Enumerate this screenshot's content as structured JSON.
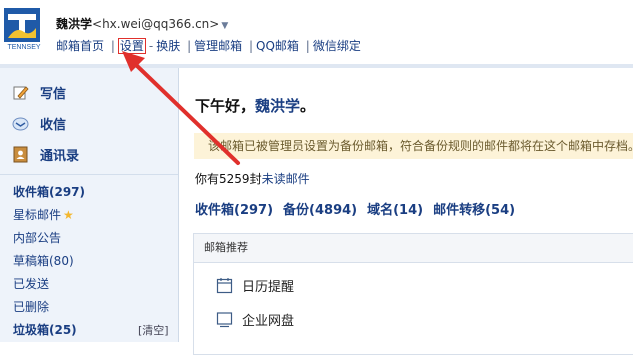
{
  "header": {
    "logo_text": "TENNSEY",
    "user_name": "魏洪学",
    "user_email": "<hx.wei@qq366.cn>",
    "nav": {
      "home": "邮箱首页",
      "settings": "设置",
      "sep_dash": "-",
      "skin": "换肤",
      "manage": "管理邮箱",
      "qqmail": "QQ邮箱",
      "wechat": "微信绑定"
    }
  },
  "sidebar": {
    "actions": {
      "compose": "写信",
      "receive": "收信",
      "contacts": "通讯录"
    },
    "folders": {
      "inbox": "收件箱(297)",
      "starred": "星标邮件",
      "announce": "内部公告",
      "drafts": "草稿箱(80)",
      "sent": "已发送",
      "deleted": "已删除",
      "junk": "垃圾箱(25)",
      "clear": "[清空]"
    }
  },
  "main": {
    "greeting_prefix": "下午好，",
    "greeting_name": "魏洪学",
    "greeting_suffix": "。",
    "notice": "该邮箱已被管理员设置为备份邮箱，符合备份规则的邮件都将在这个邮箱中存档。",
    "unread_prefix": "你有",
    "unread_count": "5259",
    "unread_mid": "封",
    "unread_link": "未读邮件",
    "stats": {
      "inbox": "收件箱(297)",
      "backup": "备份(4894)",
      "domain": "域名(14)",
      "forward": "邮件转移(54)"
    },
    "panel": {
      "title": "邮箱推荐",
      "calendar": "日历提醒",
      "netdisk": "企业网盘"
    }
  },
  "colors": {
    "link": "#1a3e82",
    "sidebar_bg": "#eef3fa",
    "notice_bg": "#fdf3d8",
    "annotation": "#e0302c"
  }
}
